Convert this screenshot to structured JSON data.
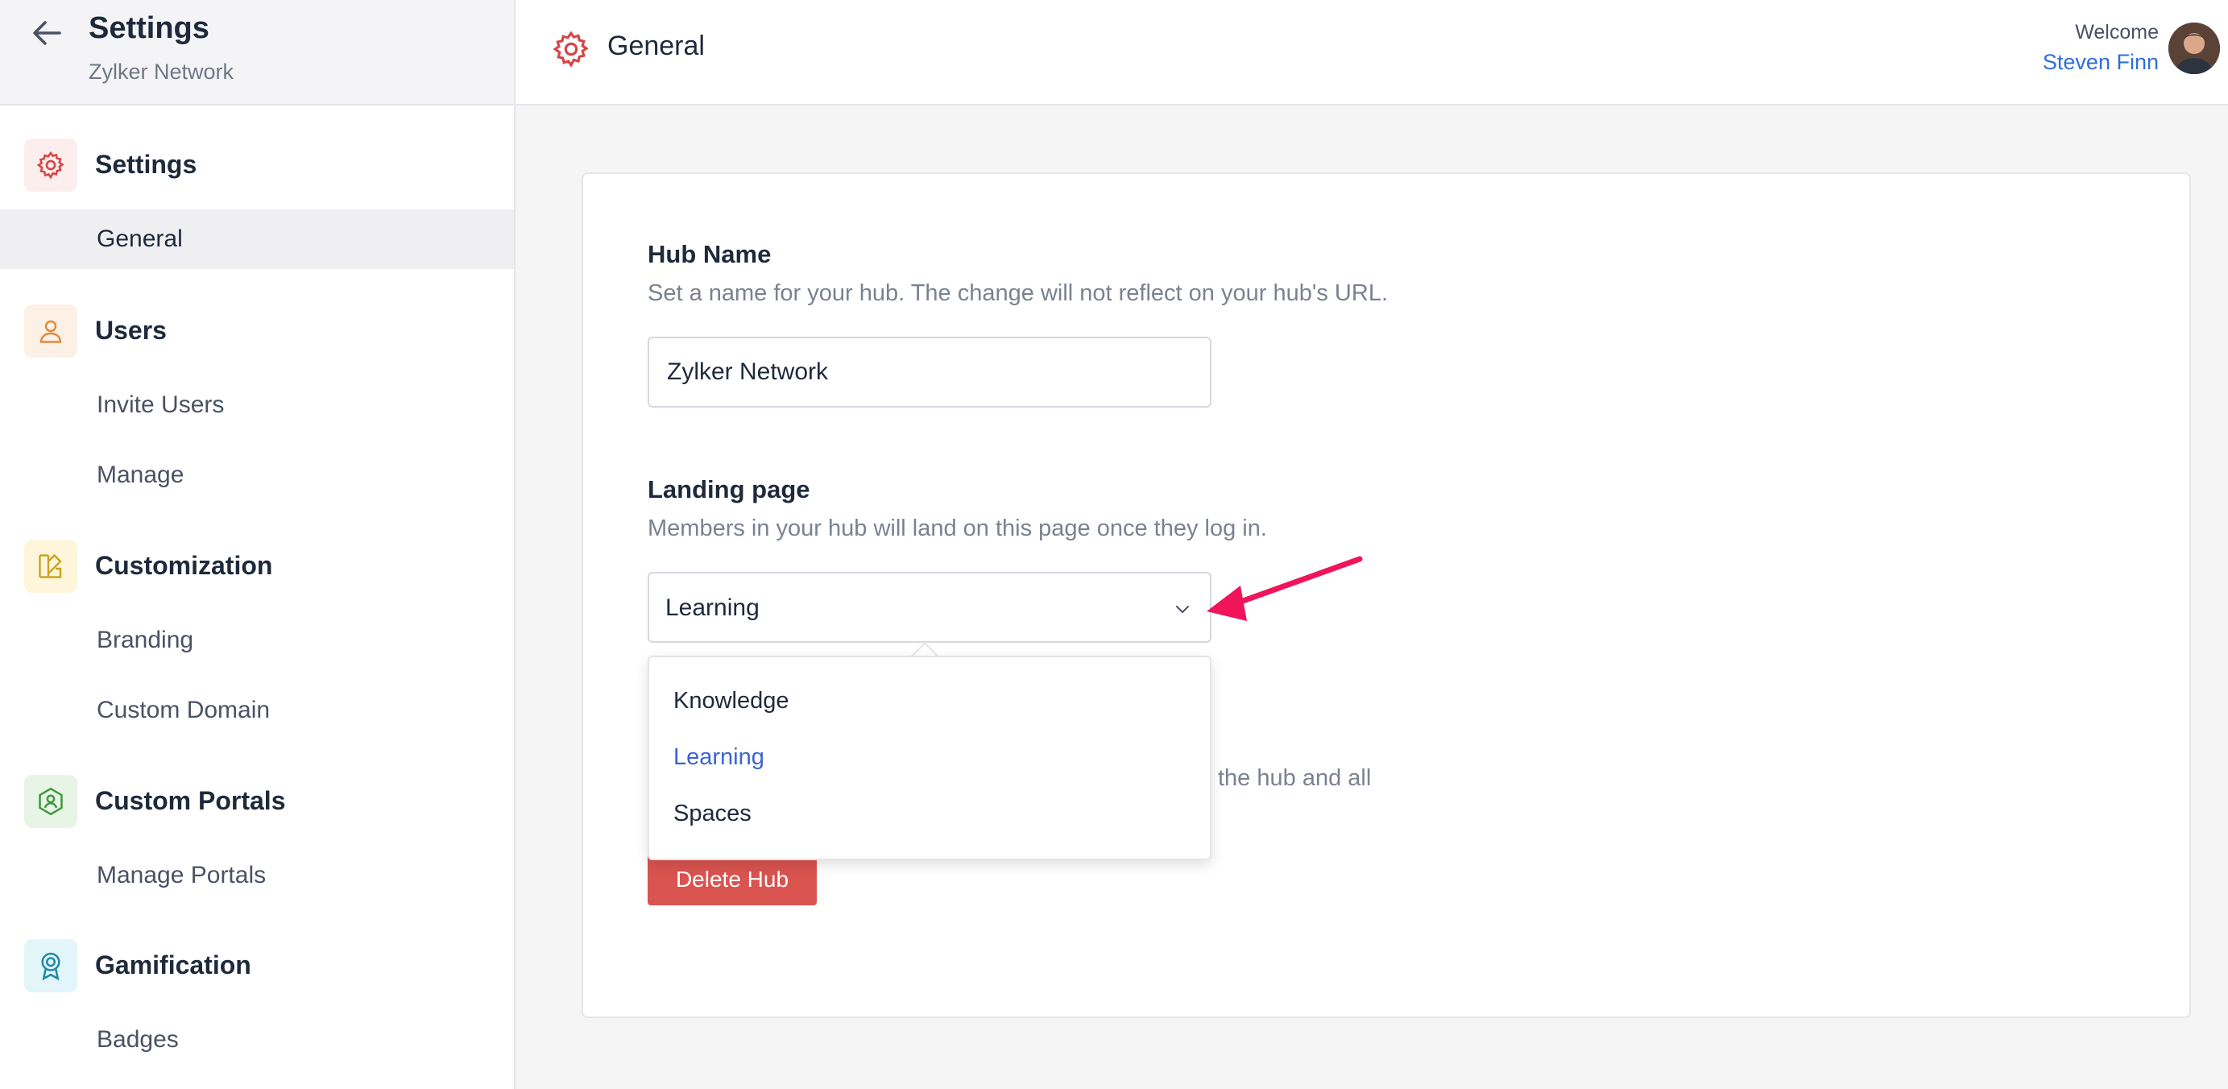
{
  "sidebar": {
    "title": "Settings",
    "subtitle": "Zylker Network",
    "sections": [
      {
        "label": "Settings",
        "icon": "gear-icon",
        "color": "#d64545",
        "bg": "#fdeeee"
      },
      {
        "label": "Users",
        "icon": "user-icon",
        "color": "#e08a3c",
        "bg": "#fdf0e4"
      },
      {
        "label": "Customization",
        "icon": "palette-icon",
        "color": "#c9a227",
        "bg": "#fdf6da"
      },
      {
        "label": "Custom Portals",
        "icon": "portal-icon",
        "color": "#3f9a3f",
        "bg": "#e8f5e6"
      },
      {
        "label": "Gamification",
        "icon": "badge-icon",
        "color": "#1e8aa6",
        "bg": "#e2f5f8"
      }
    ],
    "items": {
      "general": "General",
      "invite_users": "Invite Users",
      "manage": "Manage",
      "branding": "Branding",
      "custom_domain": "Custom Domain",
      "manage_portals": "Manage Portals",
      "badges": "Badges"
    }
  },
  "topbar": {
    "title": "General",
    "welcome": "Welcome",
    "user_name": "Steven Finn"
  },
  "form": {
    "hub_name": {
      "title": "Hub Name",
      "description": "Set a name for your hub. The change will not reflect on your hub's URL.",
      "value": "Zylker Network"
    },
    "landing_page": {
      "title": "Landing page",
      "description": "Members in your hub will land on this page once they log in.",
      "selected": "Learning",
      "options": [
        "Knowledge",
        "Learning",
        "Spaces"
      ]
    },
    "delete": {
      "partial_text": "the hub and all",
      "button": "Delete Hub"
    }
  },
  "colors": {
    "accent": "#2f6fd8",
    "selected_option": "#3b63d6",
    "danger": "#d9534f",
    "annotation_arrow": "#f0145a"
  }
}
